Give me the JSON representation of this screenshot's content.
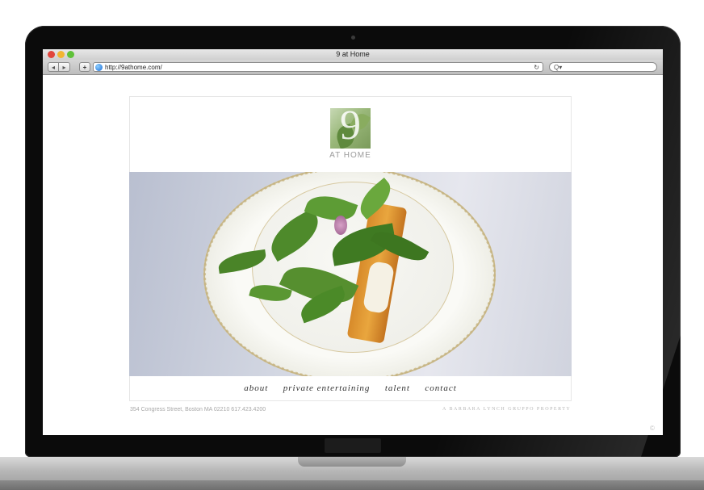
{
  "browser": {
    "window_title": "9 at Home",
    "url": "http://9athome.com/",
    "back_icon": "back-arrow-icon",
    "forward_icon": "forward-arrow-icon",
    "add_label": "+",
    "reload_glyph": "↻",
    "search_glyph": "Q▾"
  },
  "site": {
    "logo_number": "9",
    "logo_subtitle": "AT HOME",
    "hero_image": "salad-on-plate-photo",
    "nav": [
      {
        "label": "about"
      },
      {
        "label": "private entertaining"
      },
      {
        "label": "talent"
      },
      {
        "label": "contact"
      }
    ],
    "footer_address": "354 Congress Street, Boston MA 02210  617.423.4200",
    "footer_tagline": "A BARBARA LYNCH GRUPPO PROPERTY",
    "copyright_glyph": "©"
  },
  "colors": {
    "nav_text": "#333333",
    "footer_text": "#a8a8a8",
    "laptop_bezel": "#0b0b0b"
  }
}
